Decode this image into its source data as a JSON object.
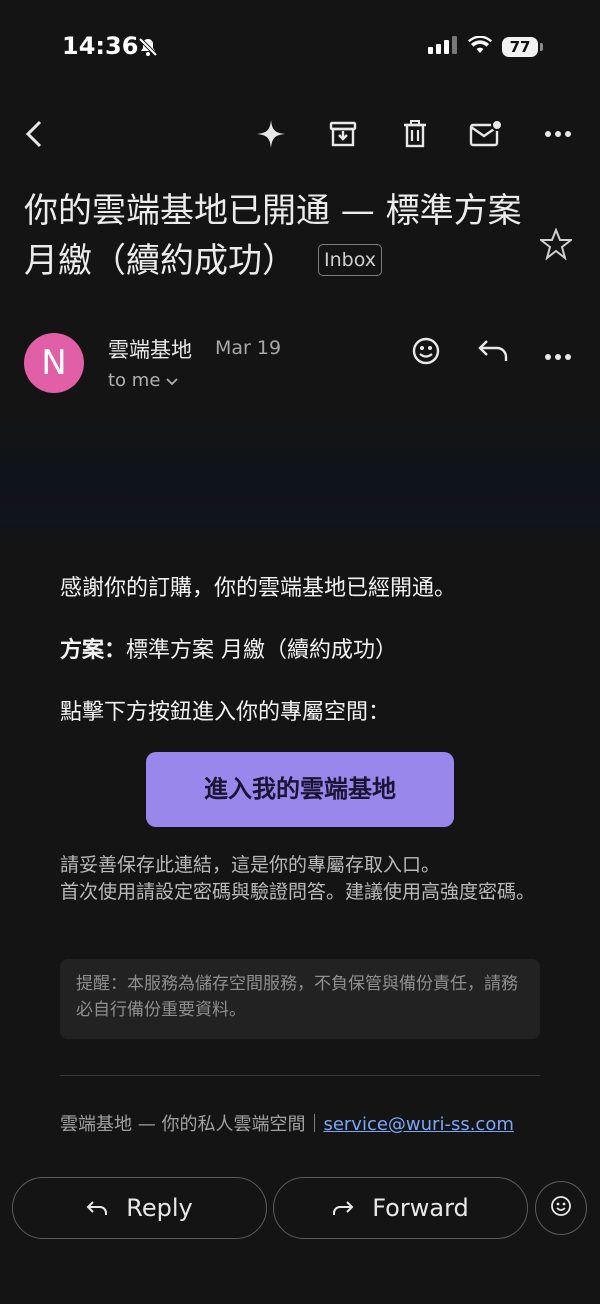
{
  "status": {
    "time": "14:36",
    "battery": "77"
  },
  "email": {
    "subject": "你的雲端基地已開通 — 標準方案 月繳（續約成功）",
    "label": "Inbox",
    "sender": {
      "initial": "N",
      "name": "雲端基地",
      "date": "Mar 19",
      "to": "to me"
    },
    "body": {
      "line1": "感謝你的訂購，你的雲端基地已經開通。",
      "plan_label": "方案：",
      "plan_value": "標準方案 月繳（續約成功）",
      "line3": "點擊下方按鈕進入你的專屬空間：",
      "cta": "進入我的雲端基地",
      "note_line1": "請妥善保存此連結，這是你的專屬存取入口。",
      "note_line2": "首次使用請設定密碼與驗證問答。建議使用高強度密碼。",
      "notice": "提醒：本服務為儲存空間服務，不負保管與備份責任，請務必自行備份重要資料。",
      "footer_text": "雲端基地 — 你的私人雲端空間｜",
      "footer_email": "service@wuri-ss.com"
    }
  },
  "actions": {
    "reply": "Reply",
    "forward": "Forward"
  },
  "colors": {
    "avatar": "#e05fa6",
    "cta": "#9a87ec",
    "link": "#7aa7f7"
  }
}
